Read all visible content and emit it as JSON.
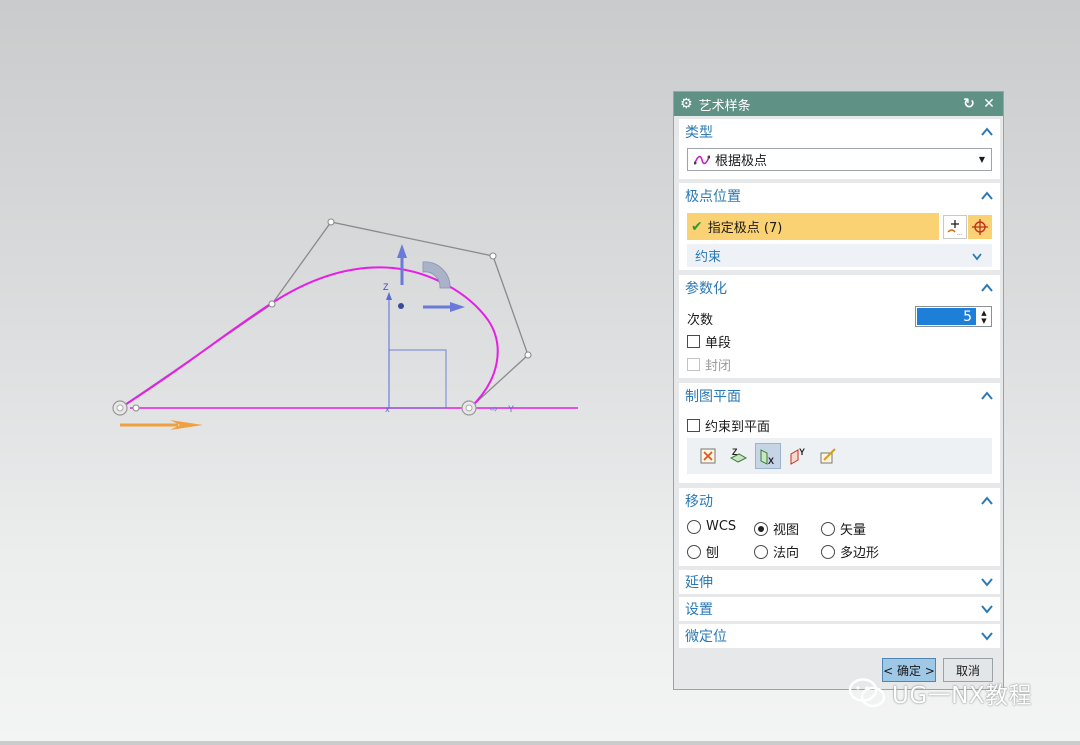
{
  "dialog": {
    "title": "艺术样条",
    "sections": {
      "type": {
        "title": "类型",
        "dropdown_value": "根据极点"
      },
      "pole_position": {
        "title": "极点位置",
        "specify_label": "指定极点 (7)",
        "constraint_label": "约束"
      },
      "parameterization": {
        "title": "参数化",
        "degree_label": "次数",
        "degree_value": "5",
        "single_segment_label": "单段",
        "single_segment_checked": false,
        "closed_label": "封闭",
        "closed_checked": false
      },
      "drawing_plane": {
        "title": "制图平面",
        "constrain_label": "约束到平面",
        "constrain_checked": false,
        "plane_icons": [
          "view-plane-icon",
          "z-plane-icon",
          "x-plane-icon",
          "y-plane-icon",
          "custom-plane-icon"
        ],
        "active_plane": "x-plane-icon"
      },
      "move": {
        "title": "移动",
        "options": [
          {
            "label": "WCS",
            "selected": false
          },
          {
            "label": "视图",
            "selected": true
          },
          {
            "label": "矢量",
            "selected": false
          },
          {
            "label": "刨",
            "selected": false
          },
          {
            "label": "法向",
            "selected": false
          },
          {
            "label": "多边形",
            "selected": false
          }
        ]
      },
      "extend": {
        "title": "延伸"
      },
      "settings": {
        "title": "设置"
      },
      "fine_position": {
        "title": "微定位"
      }
    },
    "buttons": {
      "ok": "< 确定 >",
      "cancel": "取消"
    }
  },
  "viewport": {
    "axis_z_label": "Z",
    "axis_y_label": "Y",
    "curve_color": "#e61ee6",
    "polygon_color": "#8a8a8a",
    "axis_color": "#5a6ad8",
    "handle_color": "#f0a040"
  },
  "watermark": {
    "text": "UG一NX教程"
  },
  "colors": {
    "title_bar": "#5f9185",
    "section_title": "#2a79b5",
    "highlight": "#fbd273",
    "selected_value": "#1e7fd8"
  }
}
